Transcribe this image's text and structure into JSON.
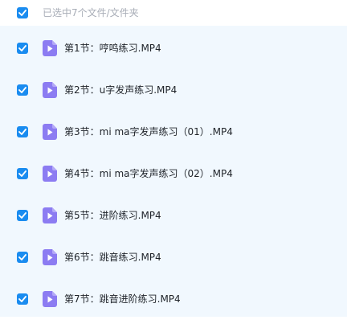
{
  "header": {
    "selected_text": "已选中7个文件/文件夹"
  },
  "files": [
    {
      "name": "第1节：哼鸣练习.MP4"
    },
    {
      "name": "第2节：u字发声练习.MP4"
    },
    {
      "name": "第3节：mi ma字发声练习（01）.MP4"
    },
    {
      "name": "第4节：mi ma字发声练习（02）.MP4"
    },
    {
      "name": "第5节：进阶练习.MP4"
    },
    {
      "name": "第6节：跳音练习.MP4"
    },
    {
      "name": "第7节：跳音进阶练习.MP4"
    }
  ],
  "icons": {
    "checkbox": "checkmark-icon",
    "file": "video-file-icon"
  },
  "colors": {
    "accent": "#1a8cf0",
    "list_background": "#f1f8fe",
    "video_icon": "#8c7cf2"
  }
}
